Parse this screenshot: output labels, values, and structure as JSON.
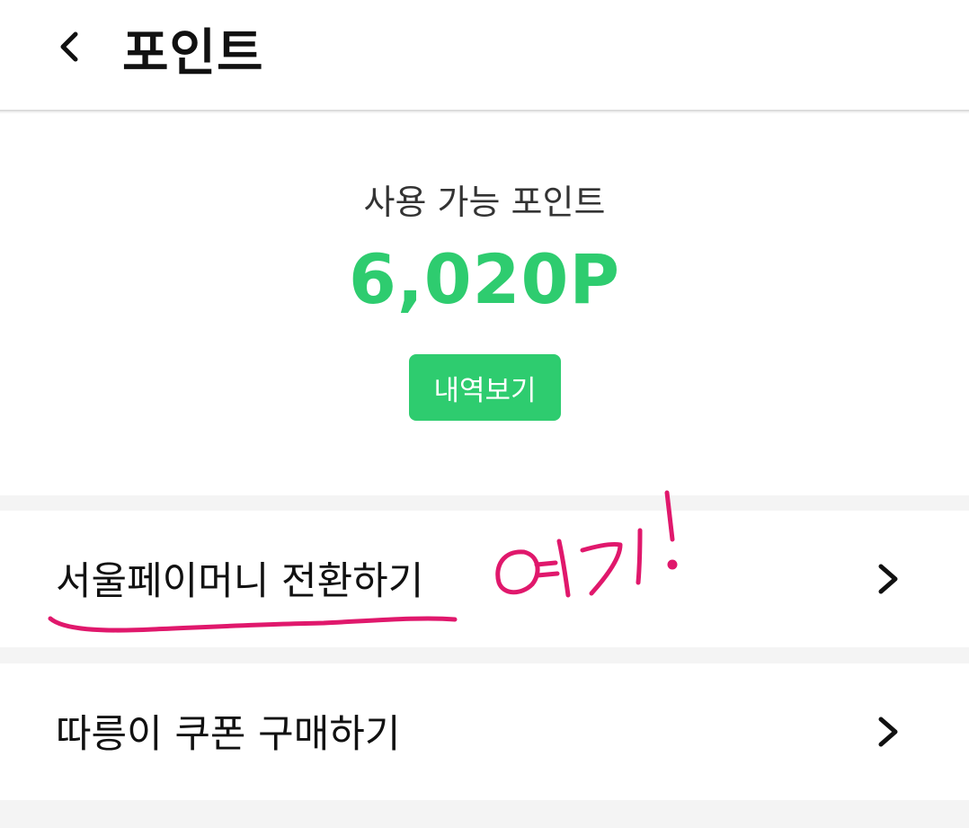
{
  "header": {
    "title": "포인트",
    "back_icon": "chevron-left-icon"
  },
  "summary": {
    "label": "사용 가능 포인트",
    "points": "6,020P",
    "history_button": "내역보기",
    "accent_color": "#2ecc6f"
  },
  "menu": {
    "items": [
      {
        "label": "서울페이머니 전환하기",
        "icon": "chevron-right-icon"
      },
      {
        "label": "따릉이 쿠폰 구매하기",
        "icon": "chevron-right-icon"
      }
    ]
  },
  "annotation": {
    "handwritten_text": "여기!",
    "color": "#e0186c"
  }
}
